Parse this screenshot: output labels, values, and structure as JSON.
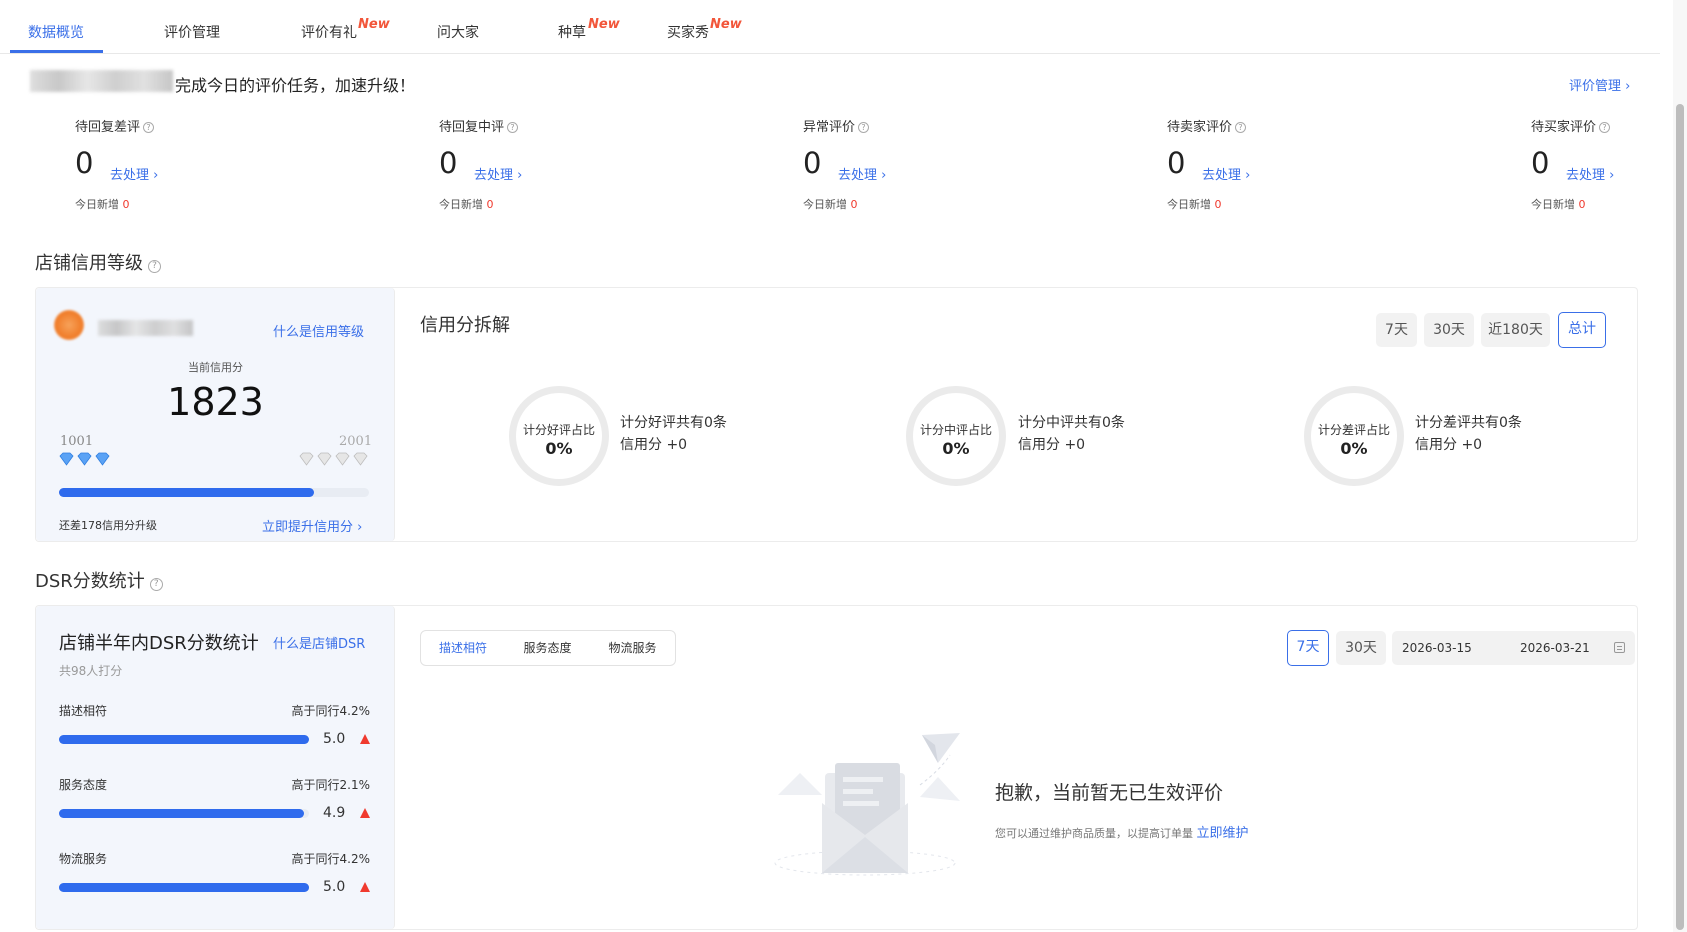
{
  "tabs": [
    {
      "label": "数据概览",
      "active": true
    },
    {
      "label": "评价管理"
    },
    {
      "label": "评价有礼",
      "badge": "New"
    },
    {
      "label": "问大家"
    },
    {
      "label": "种草",
      "badge": "New"
    },
    {
      "label": "买家秀",
      "badge": "New"
    }
  ],
  "greeting": {
    "text": "完成今日的评价任务，加速升级！",
    "manage_link": "评价管理 ›"
  },
  "stats": [
    {
      "label": "待回复差评",
      "value": "0",
      "action": "去处理 ›",
      "today_label": "今日新增",
      "today_value": "0"
    },
    {
      "label": "待回复中评",
      "value": "0",
      "action": "去处理 ›",
      "today_label": "今日新增",
      "today_value": "0"
    },
    {
      "label": "异常评价",
      "value": "0",
      "action": "去处理 ›",
      "today_label": "今日新增",
      "today_value": "0"
    },
    {
      "label": "待卖家评价",
      "value": "0",
      "action": "去处理 ›",
      "today_label": "今日新增",
      "today_value": "0"
    },
    {
      "label": "待买家评价",
      "value": "0",
      "action": "去处理 ›",
      "today_label": "今日新增",
      "today_value": "0"
    }
  ],
  "credit": {
    "section_title": "店铺信用等级",
    "what_link": "什么是信用等级",
    "current_label": "当前信用分",
    "score": "1823",
    "min": "1001",
    "max": "2001",
    "progress": 0.822,
    "remain_text": "还差178信用分升级",
    "improve_link": "立即提升信用分 ›"
  },
  "breakdown": {
    "title": "信用分拆解",
    "ranges": [
      "7天",
      "30天",
      "近180天",
      "总计"
    ],
    "active_range": "总计",
    "items": [
      {
        "ring_label": "计分好评占比",
        "ring_value": "0%",
        "line1": "计分好评共有0条",
        "line2": "信用分 +0"
      },
      {
        "ring_label": "计分中评占比",
        "ring_value": "0%",
        "line1": "计分中评共有0条",
        "line2": "信用分 +0"
      },
      {
        "ring_label": "计分差评占比",
        "ring_value": "0%",
        "line1": "计分差评共有0条",
        "line2": "信用分 +0"
      }
    ]
  },
  "dsr": {
    "section_title": "DSR分数统计",
    "card_title": "店铺半年内DSR分数统计",
    "what_link": "什么是店铺DSR",
    "raters": "共98人打分",
    "items": [
      {
        "name": "描述相符",
        "peer": "高于同行4.2%",
        "score": "5.0",
        "fill": 1.0
      },
      {
        "name": "服务态度",
        "peer": "高于同行2.1%",
        "score": "4.9",
        "fill": 0.98
      },
      {
        "name": "物流服务",
        "peer": "高于同行4.2%",
        "score": "5.0",
        "fill": 1.0
      }
    ],
    "segments": [
      "描述相符",
      "服务态度",
      "物流服务"
    ],
    "active_segment": "描述相符",
    "ranges": [
      "7天",
      "30天"
    ],
    "active_range": "7天",
    "date_start": "2026-03-15",
    "date_end": "2026-03-21",
    "empty_title": "抱歉，当前暂无已生效评价",
    "empty_desc": "您可以通过维护商品质量，以提高订单量",
    "empty_link": "立即维护"
  },
  "colors": {
    "accent": "#3a6fe8",
    "new_badge": "#f2563a",
    "up_arrow": "#f03a2e",
    "bar": "#2f6bed"
  }
}
